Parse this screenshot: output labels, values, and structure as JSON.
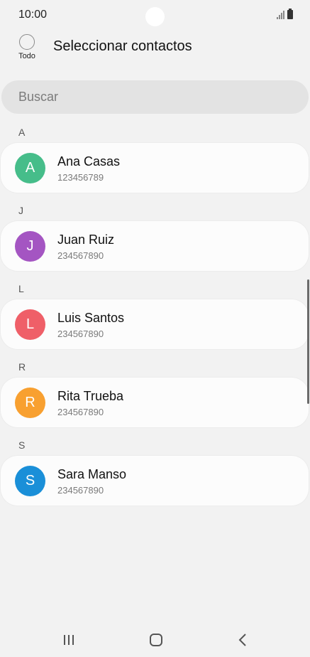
{
  "status_bar": {
    "time": "10:00",
    "icons": [
      "signal-icon",
      "battery-icon"
    ]
  },
  "header": {
    "select_all_label": "Todo",
    "title": "Seleccionar contactos"
  },
  "search": {
    "placeholder": "Buscar"
  },
  "sections": [
    {
      "letter": "A",
      "contacts": [
        {
          "initial": "A",
          "name": "Ana Casas",
          "number": "123456789",
          "color": "#46bd8a"
        }
      ]
    },
    {
      "letter": "J",
      "contacts": [
        {
          "initial": "J",
          "name": "Juan Ruiz",
          "number": "234567890",
          "color": "#a455c2"
        }
      ]
    },
    {
      "letter": "L",
      "contacts": [
        {
          "initial": "L",
          "name": "Luis Santos",
          "number": "234567890",
          "color": "#ef5f68"
        }
      ]
    },
    {
      "letter": "R",
      "contacts": [
        {
          "initial": "R",
          "name": "Rita Trueba",
          "number": "234567890",
          "color": "#f8a030"
        }
      ]
    },
    {
      "letter": "S",
      "contacts": [
        {
          "initial": "S",
          "name": "Sara Manso",
          "number": "234567890",
          "color": "#1a8fd8"
        }
      ]
    }
  ],
  "nav_bar": {
    "icons": [
      "recent-apps-icon",
      "home-icon",
      "back-icon"
    ]
  }
}
